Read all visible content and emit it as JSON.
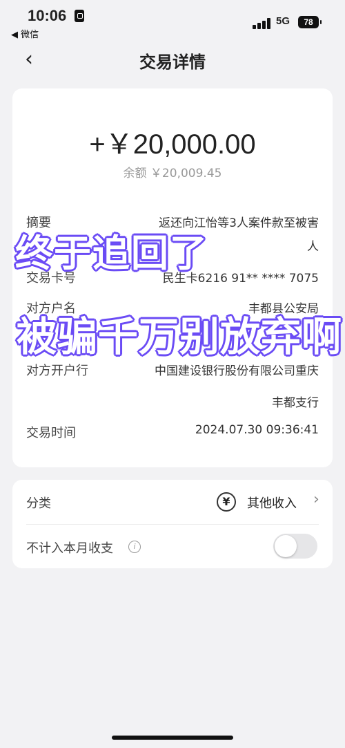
{
  "status_bar": {
    "time": "10:06",
    "back_app": "◀ 微信",
    "network": "5G",
    "battery": "78"
  },
  "nav": {
    "back_icon": "chevron-left-icon",
    "title": "交易详情"
  },
  "transaction": {
    "amount": "+￥20,000.00",
    "balance": "余额 ￥20,009.45",
    "rows": {
      "summary_label": "摘要",
      "summary_value_line1": "返还向江怡等3人案件款至被害",
      "summary_value_line2": "人",
      "card_label": "交易卡号",
      "card_value": "民生卡6216 91** **** 7075",
      "counterparty_label": "对方户名",
      "counterparty_value": "丰都县公安局",
      "bank_label": "对方开户行",
      "bank_value_line1": "中国建设银行股份有限公司重庆",
      "bank_value_line2": "丰都支行",
      "time_label": "交易时间",
      "time_value": "2024.07.30 09:36:41"
    }
  },
  "overlay_text": {
    "line1": "终于追回了",
    "line2": "被骗千万别放弃啊"
  },
  "settings": {
    "category_label": "分类",
    "category_value": "其他收入",
    "category_icon": "income-icon",
    "exclude_label": "不计入本月收支",
    "exclude_toggle_on": false
  },
  "colors": {
    "overlay_stroke": "#6b4cf5",
    "background": "#f2f2f4"
  }
}
